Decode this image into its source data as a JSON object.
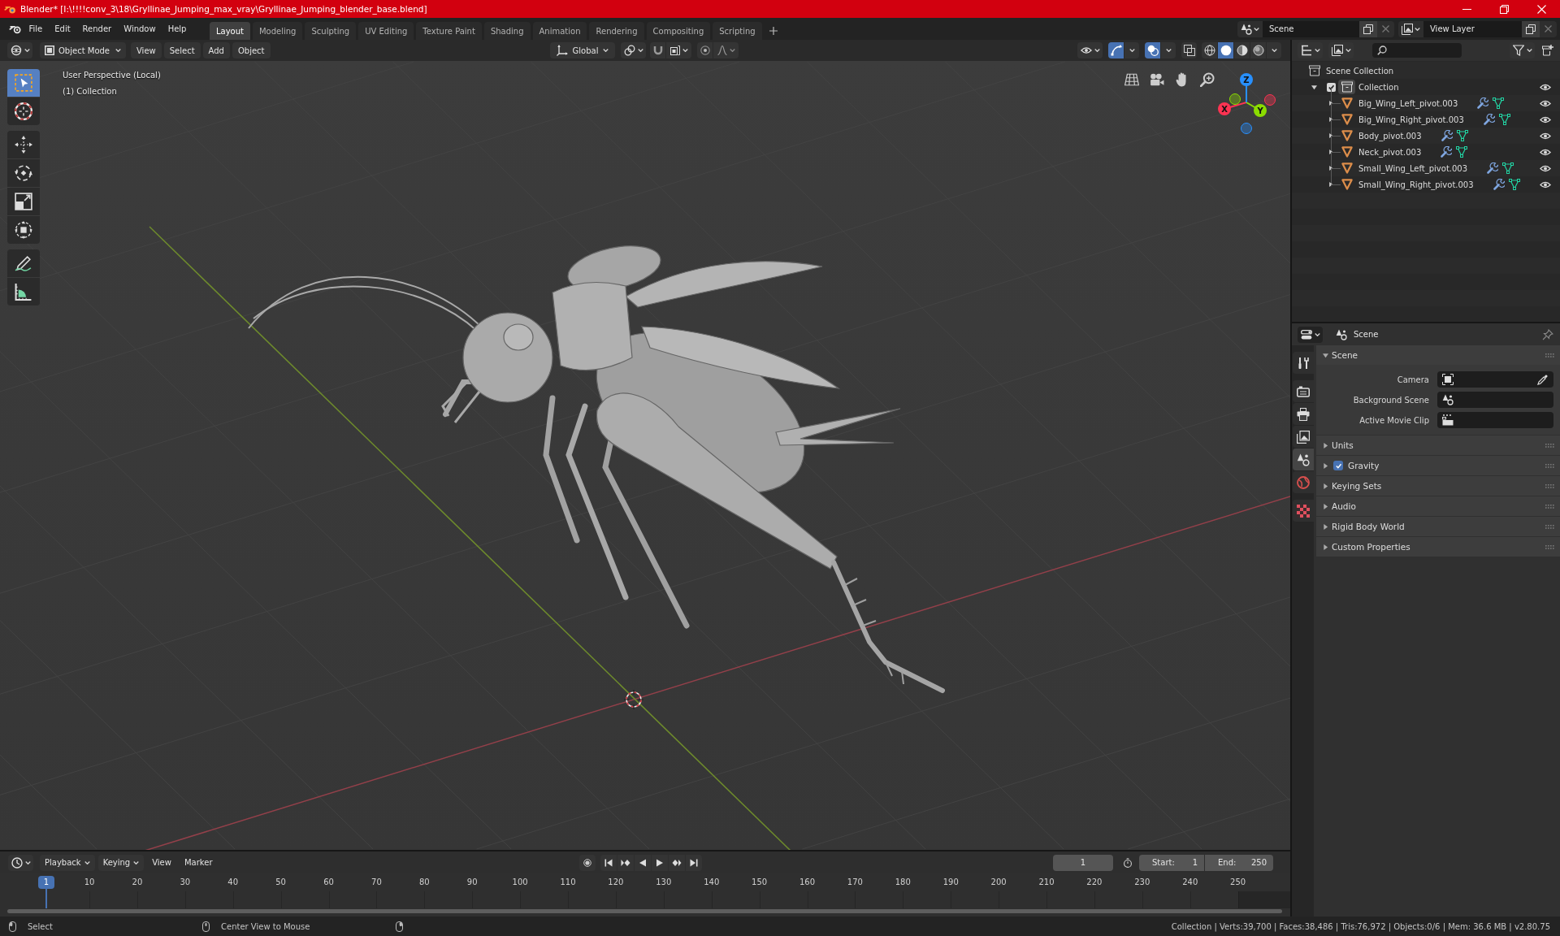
{
  "title_bar": {
    "title": "Blender* [I:\\!!!!conv_3\\18\\Gryllinae_Jumping_max_vray\\Gryllinae_Jumping_blender_base.blend]"
  },
  "menu_bar": {
    "menus": [
      "File",
      "Edit",
      "Render",
      "Window",
      "Help"
    ],
    "workspaces": [
      {
        "label": "Layout",
        "selected": true
      },
      {
        "label": "Modeling",
        "selected": false
      },
      {
        "label": "Sculpting",
        "selected": false
      },
      {
        "label": "UV Editing",
        "selected": false
      },
      {
        "label": "Texture Paint",
        "selected": false
      },
      {
        "label": "Shading",
        "selected": false
      },
      {
        "label": "Animation",
        "selected": false
      },
      {
        "label": "Rendering",
        "selected": false
      },
      {
        "label": "Compositing",
        "selected": false
      },
      {
        "label": "Scripting",
        "selected": false
      }
    ],
    "scene": "Scene",
    "view_layer": "View Layer"
  },
  "viewport": {
    "mode": "Object Mode",
    "menus": [
      "View",
      "Select",
      "Add",
      "Object"
    ],
    "orientation": "Global",
    "toggles": [
      {
        "kind": "gizmos",
        "on": true
      },
      {
        "kind": "overlays",
        "on": true
      },
      {
        "kind": "xray",
        "on": false
      }
    ],
    "shading": [
      {
        "kind": "wireframe",
        "selected": false
      },
      {
        "kind": "solid",
        "selected": true
      },
      {
        "kind": "material",
        "selected": false
      },
      {
        "kind": "rendered",
        "selected": false
      }
    ],
    "info": [
      "User Perspective (Local)",
      "(1) Collection"
    ],
    "tool_groups": [
      {
        "tools": [
          {
            "kind": "select-box",
            "selected": true
          },
          {
            "kind": "cursor",
            "selected": false
          }
        ]
      },
      {
        "tools": [
          {
            "kind": "move",
            "selected": false
          },
          {
            "kind": "rotate",
            "selected": false
          },
          {
            "kind": "scale",
            "selected": false
          },
          {
            "kind": "transform",
            "selected": false
          }
        ]
      },
      {
        "tools": [
          {
            "kind": "annotate",
            "selected": false
          },
          {
            "kind": "measure",
            "selected": false
          }
        ]
      }
    ],
    "gizmo_axes": [
      {
        "label": "X",
        "color": "#ff3352"
      },
      {
        "label": "Y",
        "color": "#8bdc00"
      },
      {
        "label": "Z",
        "color": "#2890ff"
      }
    ]
  },
  "outliner": {
    "root": "Scene Collection",
    "collections": [
      {
        "name": "Collection",
        "checked": true,
        "expanded": true,
        "visible": true,
        "children": [
          {
            "name": "Big_Wing_Left_pivot.003",
            "expanded": false,
            "visible": true
          },
          {
            "name": "Big_Wing_Right_pivot.003",
            "expanded": false,
            "visible": true
          },
          {
            "name": "Body_pivot.003",
            "expanded": false,
            "visible": true
          },
          {
            "name": "Neck_pivot.003",
            "expanded": false,
            "visible": true
          },
          {
            "name": "Small_Wing_Left_pivot.003",
            "expanded": false,
            "visible": true
          },
          {
            "name": "Small_Wing_Right_pivot.003",
            "expanded": false,
            "visible": true
          }
        ]
      }
    ]
  },
  "properties": {
    "context": "Scene",
    "tab_groups": [
      {
        "tabs": [
          {
            "kind": "tool",
            "selected": false
          }
        ]
      },
      {
        "tabs": [
          {
            "kind": "render",
            "selected": false
          },
          {
            "kind": "output",
            "selected": false
          },
          {
            "kind": "view-layer",
            "selected": false
          },
          {
            "kind": "scene",
            "selected": true
          },
          {
            "kind": "world",
            "selected": false
          }
        ]
      },
      {
        "tabs": [
          {
            "kind": "texture",
            "selected": false
          }
        ]
      }
    ],
    "panels": [
      {
        "title": "Scene",
        "expanded": true,
        "fields": [
          {
            "label": "Camera",
            "kind": "camera"
          },
          {
            "label": "Background Scene",
            "kind": "scene"
          },
          {
            "label": "Active Movie Clip",
            "kind": "movie-clip"
          }
        ]
      },
      {
        "title": "Units",
        "expanded": false
      },
      {
        "title": "Gravity",
        "expanded": false,
        "checked": true
      },
      {
        "title": "Keying Sets",
        "expanded": false
      },
      {
        "title": "Audio",
        "expanded": false
      },
      {
        "title": "Rigid Body World",
        "expanded": false
      },
      {
        "title": "Custom Properties",
        "expanded": false
      }
    ]
  },
  "timeline": {
    "menus": [
      {
        "label": "Playback",
        "dropdown": true
      },
      {
        "label": "Keying",
        "dropdown": true
      },
      {
        "label": "View",
        "dropdown": false
      },
      {
        "label": "Marker",
        "dropdown": false
      }
    ],
    "current_frame": "1",
    "start_label": "Start:",
    "start": "1",
    "end_label": "End:",
    "end": "250",
    "playhead": "1",
    "ruler": [
      "10",
      "20",
      "30",
      "40",
      "50",
      "60",
      "70",
      "80",
      "90",
      "100",
      "110",
      "120",
      "130",
      "140",
      "150",
      "160",
      "170",
      "180",
      "190",
      "200",
      "210",
      "220",
      "230",
      "240",
      "250"
    ]
  },
  "status_bar": {
    "hints": [
      {
        "kind": "left-click",
        "label": "Select"
      },
      {
        "kind": "middle-click",
        "label": "Center View to Mouse"
      },
      {
        "kind": "right-click"
      }
    ],
    "stats": "Collection | Verts:39,700 | Faces:38,486 | Tris:76,972 | Objects:0/6 | Mem: 36.6 MB | v2.80.75"
  }
}
